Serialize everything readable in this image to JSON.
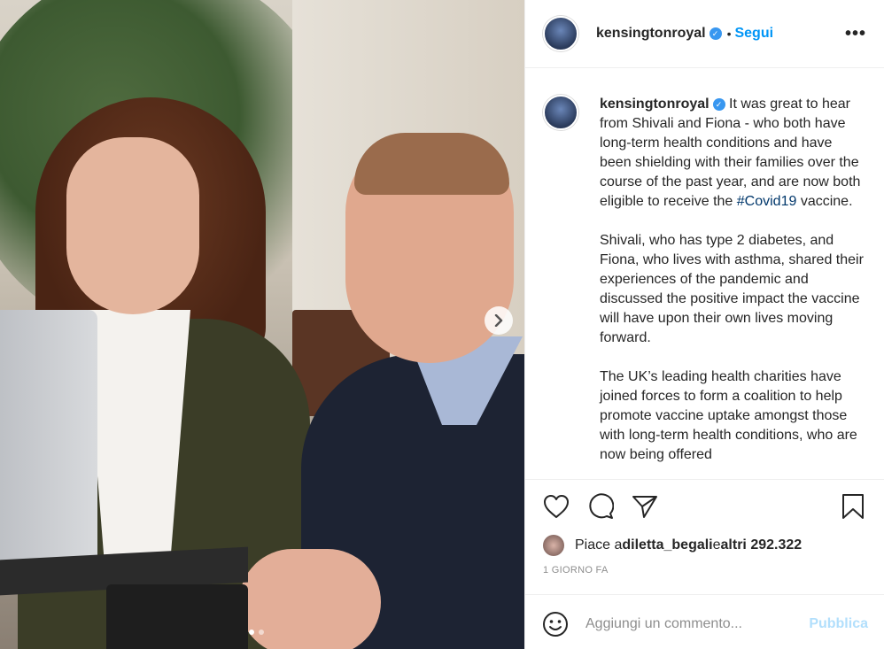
{
  "post": {
    "username": "kensingtonroyal",
    "follow_label": "Segui",
    "separator": "•",
    "more_label": "•••"
  },
  "caption": {
    "username": "kensingtonroyal",
    "p1_before": " It was great to hear from Shivali and Fiona - who both have long-term health conditions and have been shielding with their families over the course of the past year, and are now both eligible to receive the ",
    "hashtag": "#Covid19",
    "p1_after": " vaccine.",
    "p2": "Shivali, who has type 2 diabetes, and Fiona, who lives with asthma, shared their experiences of the pandemic and discussed the positive impact the vaccine will have upon their own lives moving forward.",
    "p3": "The UK’s leading health charities have joined forces to form a coalition to help promote vaccine uptake amongst those with long-term health conditions, who are now being offered"
  },
  "likes": {
    "prefix": "Piace a ",
    "user": "diletta_begali",
    "middle": " e ",
    "others": "altri 292.322"
  },
  "time_label": "1 GIORNO FA",
  "comment": {
    "placeholder": "Aggiungi un commento...",
    "publish_label": "Pubblica"
  },
  "carousel": {
    "count": 2,
    "active": 1
  },
  "icons": [
    "heart-icon",
    "comment-icon",
    "share-icon",
    "bookmark-icon",
    "emoji-icon",
    "chevron-right-icon",
    "more-icon",
    "verified-icon"
  ],
  "colors": {
    "accent": "#0095f6",
    "publish_disabled": "#b2dffc",
    "hashtag": "#00376b",
    "verified": "#3897f0"
  }
}
